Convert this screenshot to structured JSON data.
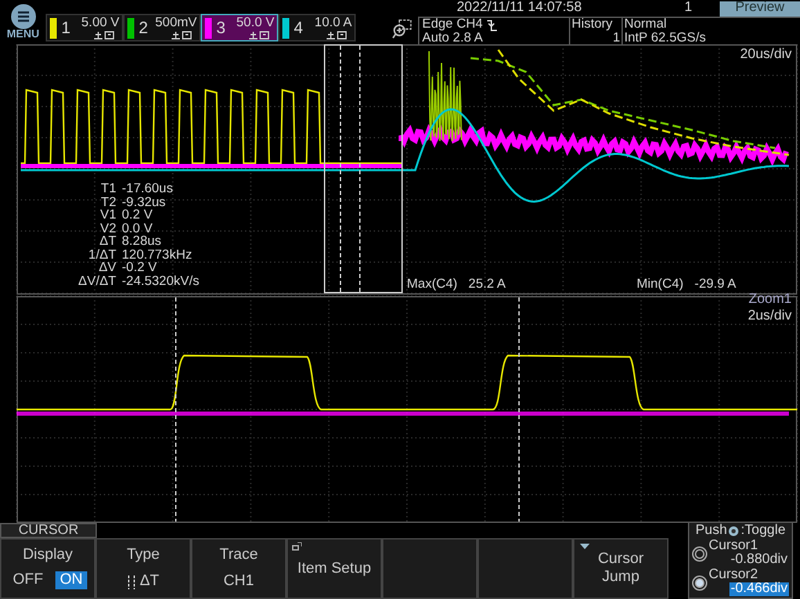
{
  "menu": {
    "label": "MENU"
  },
  "channels": [
    {
      "number": "1",
      "scale": "5.00 V",
      "color": "#e6e600",
      "selected": false
    },
    {
      "number": "2",
      "scale": "500mV",
      "color": "#00c000",
      "selected": false
    },
    {
      "number": "3",
      "scale": "50.0 V",
      "color": "#ff00ff",
      "selected": true
    },
    {
      "number": "4",
      "scale": "10.0 A",
      "color": "#00c8d0",
      "selected": false
    }
  ],
  "datetime": "2022/11/11 14:07:58",
  "acquisition_count": "1",
  "preview_button": "Preview",
  "trigger": {
    "source": "Edge CH4",
    "level": "Auto 2.8 A"
  },
  "history": {
    "label": "History",
    "value": "1"
  },
  "mode": {
    "label": "Normal",
    "sample_rate": "IntP 62.5GS/s"
  },
  "main_timebase": "20us/div",
  "cursor_readouts": [
    {
      "label": "T1",
      "value": "-17.60us"
    },
    {
      "label": "T2",
      "value": "-9.32us"
    },
    {
      "label": "V1",
      "value": "0.2 V"
    },
    {
      "label": "V2",
      "value": "0.0 V"
    },
    {
      "label": "ΔT",
      "value": "8.28us"
    },
    {
      "label": "1/ΔT",
      "value": "120.773kHz"
    },
    {
      "label": "ΔV",
      "value": "-0.2 V"
    },
    {
      "label": "ΔV/ΔT",
      "value": "-24.5320kV/s"
    }
  ],
  "measurements": [
    {
      "label": "Max(C4)",
      "value": "25.2 A"
    },
    {
      "label": "Min(C4)",
      "value": "-29.9 A"
    }
  ],
  "zoom": {
    "label": "Zoom1",
    "timebase": "2us/div"
  },
  "menu_title": "CURSOR",
  "softkeys": [
    {
      "kind": "toggle",
      "label": "Display",
      "options": [
        {
          "label": "OFF",
          "selected": false
        },
        {
          "label": "ON",
          "selected": true
        }
      ]
    },
    {
      "kind": "value",
      "label": "Type",
      "value": "ΔT"
    },
    {
      "kind": "value",
      "label": "Trace",
      "value": "CH1"
    },
    {
      "kind": "setup",
      "label": "Item Setup"
    },
    {
      "kind": "empty"
    },
    {
      "kind": "empty"
    },
    {
      "kind": "menu",
      "label": "Cursor Jump"
    }
  ],
  "knob_panel": {
    "prefix": "Push",
    "suffix": ":Toggle",
    "cursors": [
      {
        "label": "Cursor1",
        "value": "-0.880div",
        "selected": false
      },
      {
        "label": "Cursor2",
        "value": "-0.466div",
        "selected": true
      }
    ]
  }
}
